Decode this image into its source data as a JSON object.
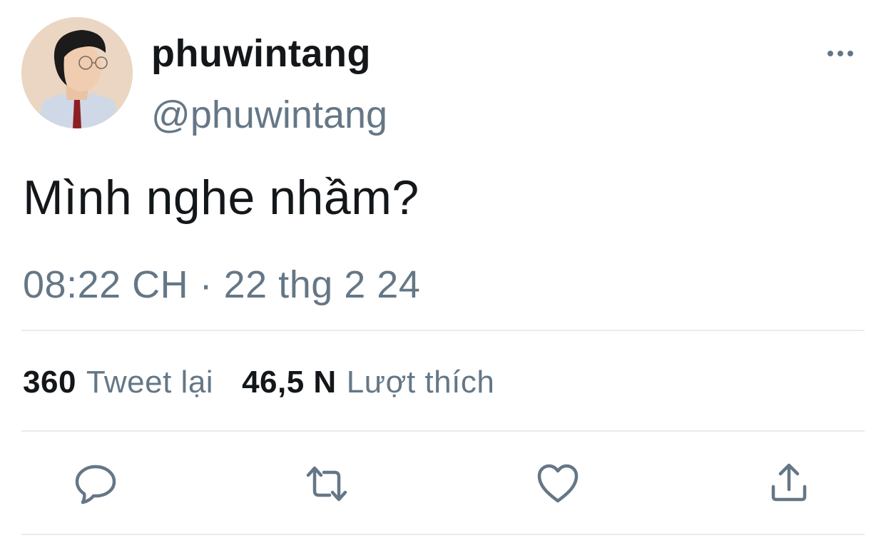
{
  "user": {
    "display_name": "phuwintang",
    "handle": "@phuwintang"
  },
  "tweet": {
    "text": "Mình nghe nhầm?",
    "timestamp": "08:22 CH · 22 thg 2 24"
  },
  "stats": {
    "retweets_count": "360",
    "retweets_label": "Tweet lại",
    "likes_count": "46,5 N",
    "likes_label": "Lượt thích"
  },
  "icons": {
    "more": "more-horizontal-icon",
    "reply": "reply-icon",
    "retweet": "retweet-icon",
    "like": "heart-icon",
    "share": "share-icon"
  },
  "colors": {
    "text_primary": "#14171a",
    "text_secondary": "#657786",
    "divider": "#e6ecf0"
  }
}
